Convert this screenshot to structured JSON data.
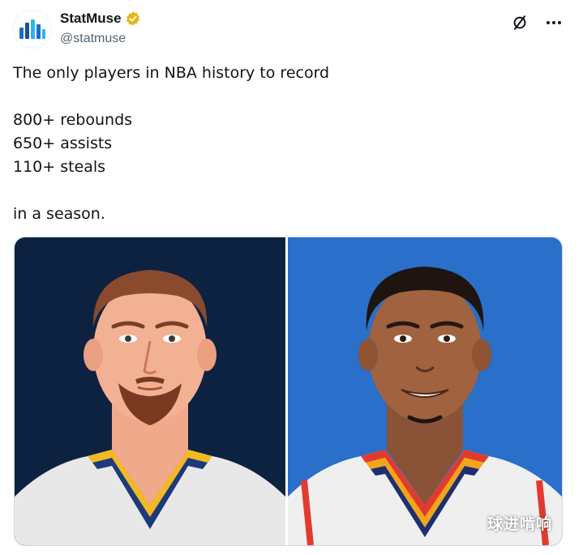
{
  "author": {
    "display_name": "StatMuse",
    "handle": "@statmuse",
    "verified": true,
    "avatar_icon": "statmuse-logo-icon",
    "verified_color": "#e2b719"
  },
  "actions": {
    "grok_icon": "grok-icon",
    "more_icon": "more-options-icon"
  },
  "tweet": {
    "line1": "The only players in NBA history to record",
    "line2": "800+ rebounds",
    "line3": "650+ assists",
    "line4": "110+ steals",
    "line5": "in a season."
  },
  "media": {
    "left_bg": "#0d2240",
    "right_bg": "#2a6fc9",
    "left_player_icon": "player-illustration-left",
    "right_player_icon": "player-illustration-right"
  },
  "watermark": "球进啃响"
}
